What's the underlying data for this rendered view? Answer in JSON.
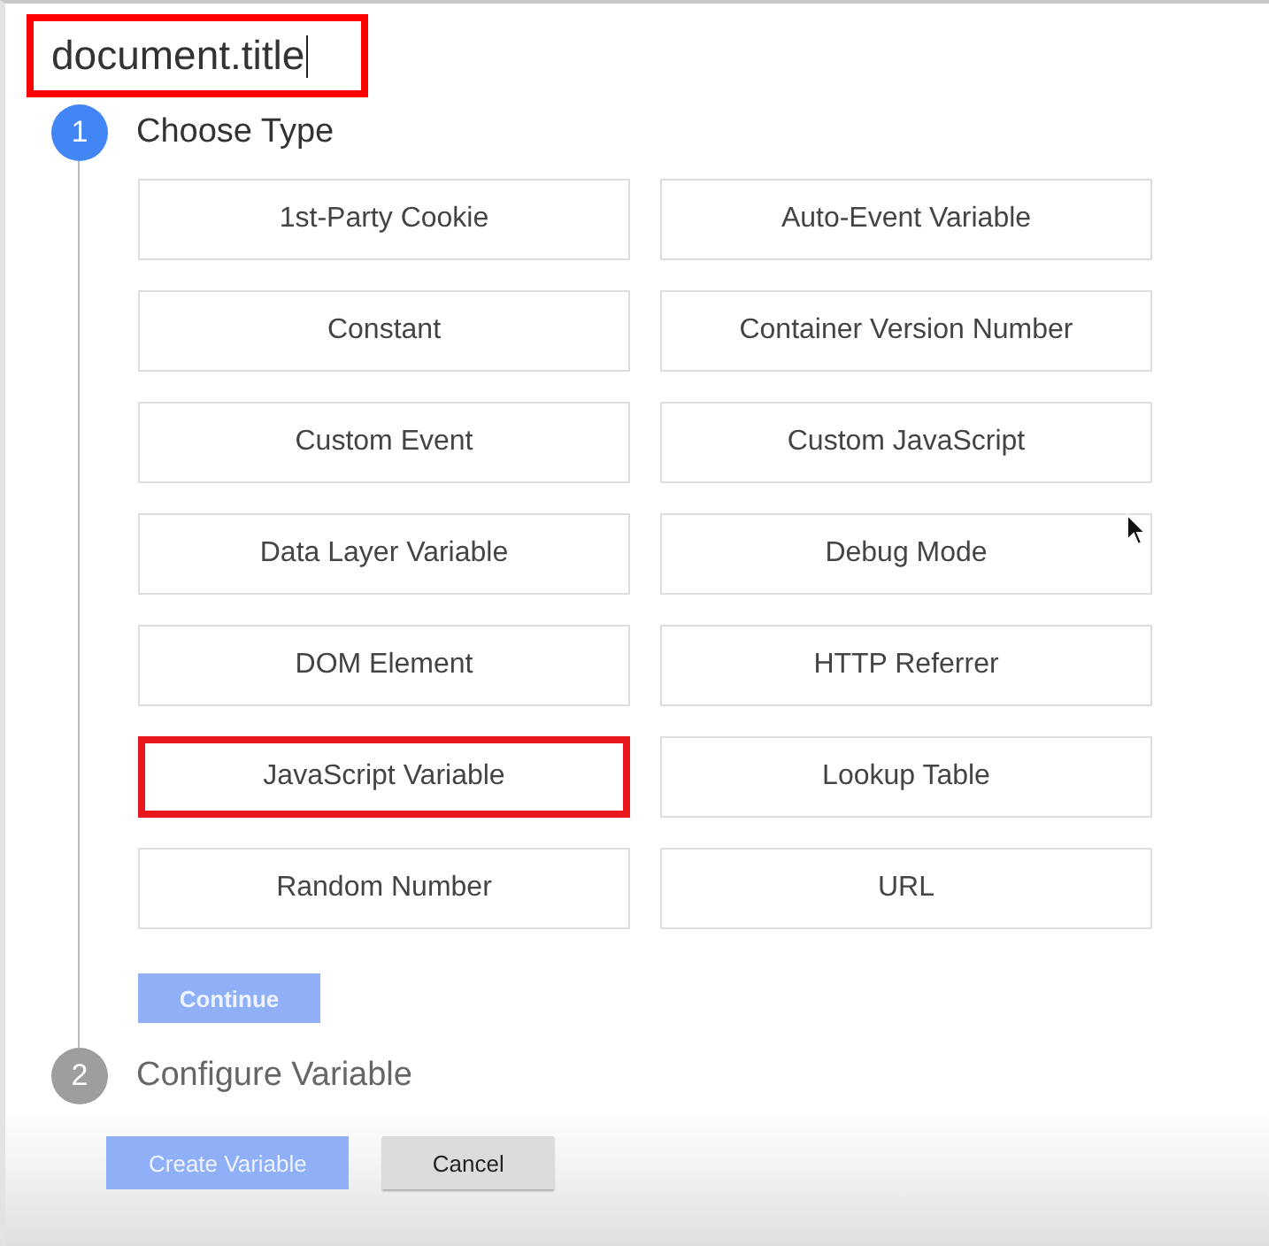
{
  "name_field": {
    "value": "document.title",
    "highlighted": true
  },
  "steps": [
    {
      "number": "1",
      "title": "Choose Type",
      "active": true
    },
    {
      "number": "2",
      "title": "Configure Variable",
      "active": false
    }
  ],
  "variable_types": [
    {
      "label": "1st-Party Cookie",
      "highlighted": false
    },
    {
      "label": "Auto-Event Variable",
      "highlighted": false
    },
    {
      "label": "Constant",
      "highlighted": false
    },
    {
      "label": "Container Version Number",
      "highlighted": false
    },
    {
      "label": "Custom Event",
      "highlighted": false
    },
    {
      "label": "Custom JavaScript",
      "highlighted": false
    },
    {
      "label": "Data Layer Variable",
      "highlighted": false
    },
    {
      "label": "Debug Mode",
      "highlighted": false
    },
    {
      "label": "DOM Element",
      "highlighted": false
    },
    {
      "label": "HTTP Referrer",
      "highlighted": false
    },
    {
      "label": "JavaScript Variable",
      "highlighted": true
    },
    {
      "label": "Lookup Table",
      "highlighted": false
    },
    {
      "label": "Random Number",
      "highlighted": false
    },
    {
      "label": "URL",
      "highlighted": false
    }
  ],
  "continue_button": {
    "label": "Continue",
    "disabled": true
  },
  "footer_buttons": [
    {
      "label": "Create Variable",
      "kind": "primary",
      "disabled": true
    },
    {
      "label": "Cancel",
      "kind": "secondary",
      "disabled": false
    }
  ]
}
